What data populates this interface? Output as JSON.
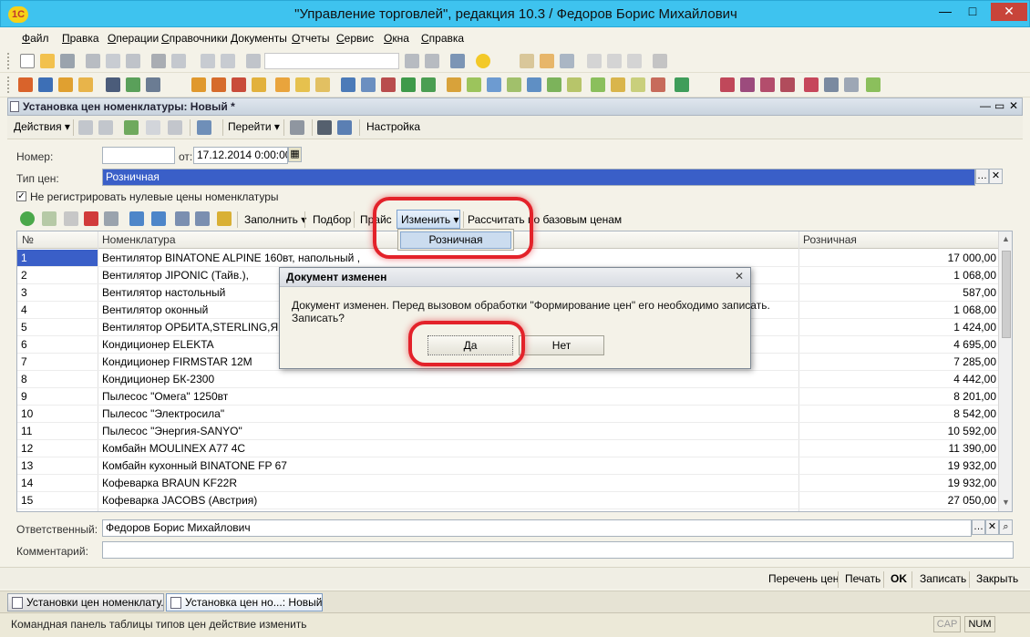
{
  "app": {
    "title": "\"Управление торговлей\", редакция 10.3 / Федоров Борис Михайлович",
    "logo_text": "1С",
    "window_buttons": {
      "minimize": "—",
      "maximize": "□",
      "close": "✕"
    }
  },
  "menu": [
    "Файл",
    "Правка",
    "Операции",
    "Справочники",
    "Документы",
    "Отчеты",
    "Сервис",
    "Окна",
    "Справка"
  ],
  "document": {
    "title": "Установка цен номенклатуры: Новый *",
    "window_buttons": {
      "minimize": "—",
      "restore": "▭",
      "close": "✕"
    },
    "commands": {
      "actions": "Действия ▾",
      "goto": "Перейти ▾",
      "settings": "Настройка"
    },
    "form": {
      "number_label": "Номер:",
      "number_value": "",
      "date_label": "от:",
      "date_value": "17.12.2014  0:00:00",
      "price_type_label": "Тип цен:",
      "price_type_value": "Розничная",
      "zero_prices_checkbox": "Не регистрировать нулевые цены номенклатуры",
      "zero_prices_checked": true,
      "responsible_label": "Ответственный:",
      "responsible_value": "Федоров Борис Михайлович",
      "comment_label": "Комментарий:",
      "comment_value": ""
    },
    "table_toolbar": {
      "fill": "Заполнить ▾",
      "select": "Подбор",
      "price_list": "Прайс",
      "change": "Изменить ▾",
      "recalc": "Рассчитать по базовым ценам"
    },
    "table": {
      "columns": [
        "№",
        "Номенклатура",
        "Розничная"
      ],
      "rows": [
        {
          "n": "1",
          "item": "Вентилятор BINATONE ALPINE 160вт, напольный ,",
          "price": "17 000,00"
        },
        {
          "n": "2",
          "item": "Вентилятор JIPONIC (Тайв.),",
          "price": "1 068,00"
        },
        {
          "n": "3",
          "item": "Вентилятор настольный",
          "price": "587,00"
        },
        {
          "n": "4",
          "item": "Вентилятор оконный",
          "price": "1 068,00"
        },
        {
          "n": "5",
          "item": "Вентилятор ОРБИТА,STERLING,ЯП.",
          "price": "1 424,00"
        },
        {
          "n": "6",
          "item": "Кондиционер ELEKTA",
          "price": "4 695,00"
        },
        {
          "n": "7",
          "item": "Кондиционер FIRMSTAR 12M",
          "price": "7 285,00"
        },
        {
          "n": "8",
          "item": "Кондиционер БК-2300",
          "price": "4 442,00"
        },
        {
          "n": "9",
          "item": "Пылесос \"Омега\" 1250вт",
          "price": "8 201,00"
        },
        {
          "n": "10",
          "item": "Пылесос \"Электросила\"",
          "price": "8 542,00"
        },
        {
          "n": "11",
          "item": "Пылесос \"Энергия-SANYO\"",
          "price": "10 592,00"
        },
        {
          "n": "12",
          "item": "Комбайн MOULINEX A77 4C",
          "price": "11 390,00"
        },
        {
          "n": "13",
          "item": "Комбайн кухонный BINATONE FP 67",
          "price": "19 932,00"
        },
        {
          "n": "14",
          "item": "Кофеварка BRAUN KF22R",
          "price": "19 932,00"
        },
        {
          "n": "15",
          "item": "Кофеварка JACOBS (Австрия)",
          "price": "27 050,00"
        }
      ]
    },
    "popup_menu": {
      "item": "Розничная"
    },
    "bottom_commands": [
      "Перечень цен",
      "Печать",
      "OK",
      "Записать",
      "Закрыть"
    ]
  },
  "dialog": {
    "title": "Документ изменен",
    "message_line1": "Документ изменен. Перед вызовом обработки \"Формирование цен\" его необходимо записать.",
    "message_line2": "Записать?",
    "yes": "Да",
    "no": "Нет",
    "close": "✕"
  },
  "taskbar": [
    "Установки цен номенклату...",
    "Установка цен но...: Новый *"
  ],
  "status": {
    "text": "Командная панель таблицы типов цен действие изменить",
    "cap": "CAP",
    "num": "NUM"
  },
  "colors": {
    "titlebar": "#3ec3ef",
    "selection": "#3a5fc8",
    "annotation_red": "#e3222a"
  }
}
